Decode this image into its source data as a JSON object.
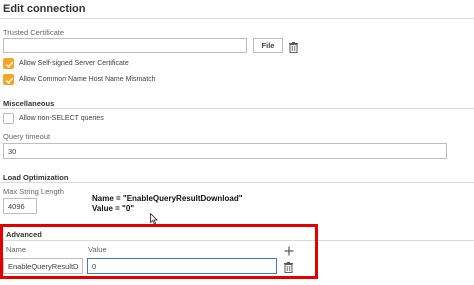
{
  "header": {
    "title": "Edit connection"
  },
  "trusted_certificate": {
    "label": "Trusted Certificate",
    "value": "",
    "file_button": "File"
  },
  "ssl_options": [
    {
      "label": "Allow Self-signed Server Certificate",
      "checked": true
    },
    {
      "label": "Allow Common Name Host Name Mismatch",
      "checked": true
    }
  ],
  "miscellaneous": {
    "title": "Miscellaneous",
    "allow_non_select": {
      "label": "Allow non-SELECT queries",
      "checked": false
    },
    "query_timeout": {
      "label": "Query timeout",
      "value": "30"
    }
  },
  "load_optimization": {
    "title": "Load Optimization",
    "max_string_length": {
      "label": "Max String Length",
      "value": "4096"
    }
  },
  "annotation": {
    "line1": "Name = \"EnableQueryResultDownload\"",
    "line2": "Value = \"0\""
  },
  "advanced": {
    "title": "Advanced",
    "name_header": "Name",
    "value_header": "Value",
    "rows": [
      {
        "name": "EnableQueryResultDow",
        "value": "0"
      }
    ]
  },
  "colors": {
    "checkbox_accent": "#f5a623",
    "highlight_border": "#e30000",
    "focus_border": "#3a7fc9"
  },
  "icons": [
    "trash-icon",
    "checkmark-icon",
    "plus-icon",
    "mouse-cursor-icon"
  ]
}
